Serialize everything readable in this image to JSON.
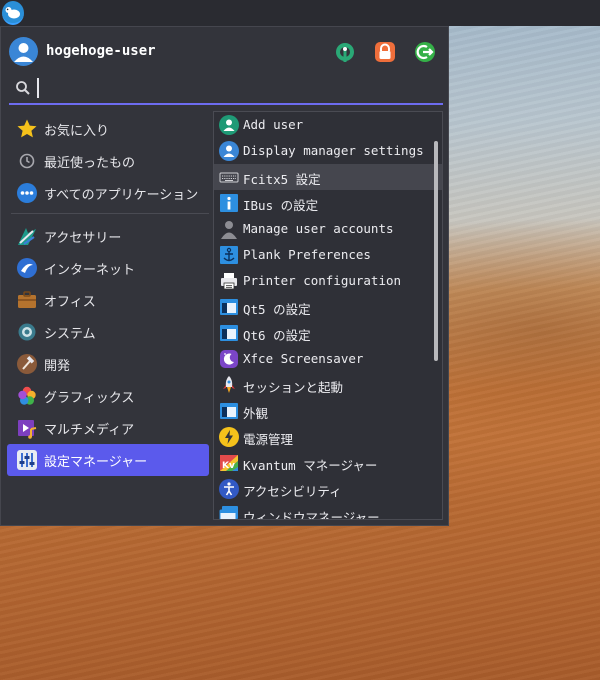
{
  "user": {
    "name": "hogehoge-user"
  },
  "header_buttons": [
    {
      "name": "settings-button",
      "icon": "wrench-gear-icon",
      "color": "#2aa876"
    },
    {
      "name": "lock-button",
      "icon": "lock-icon",
      "color": "#ef6e3b"
    },
    {
      "name": "logout-button",
      "icon": "logout-icon",
      "color": "#35b048"
    }
  ],
  "search": {
    "value": "",
    "placeholder": ""
  },
  "categories_top": [
    {
      "label": "お気に入り",
      "icon": "star-icon"
    },
    {
      "label": "最近使ったもの",
      "icon": "clock-icon"
    },
    {
      "label": "すべてのアプリケーション",
      "icon": "dots-icon"
    }
  ],
  "categories": [
    {
      "label": "アクセサリー",
      "icon": "accessories-icon"
    },
    {
      "label": "インターネット",
      "icon": "internet-icon"
    },
    {
      "label": "オフィス",
      "icon": "briefcase-icon"
    },
    {
      "label": "システム",
      "icon": "system-gear-icon"
    },
    {
      "label": "開発",
      "icon": "hammer-icon"
    },
    {
      "label": "グラフィックス",
      "icon": "graphics-icon"
    },
    {
      "label": "マルチメディア",
      "icon": "multimedia-icon"
    },
    {
      "label": "設定マネージャー",
      "icon": "settings-manager-icon",
      "selected": true
    }
  ],
  "apps": [
    {
      "label": "Add user",
      "icon": "add-user-icon"
    },
    {
      "label": "Display manager settings",
      "icon": "user-icon"
    },
    {
      "label": "Fcitx5 設定",
      "icon": "keyboard-icon",
      "hover": true
    },
    {
      "label": "IBus の設定",
      "icon": "info-icon"
    },
    {
      "label": "Manage user accounts",
      "icon": "users-icon"
    },
    {
      "label": "Plank Preferences",
      "icon": "anchor-icon"
    },
    {
      "label": "Printer configuration",
      "icon": "printer-icon"
    },
    {
      "label": "Qt5 の設定",
      "icon": "window-icon"
    },
    {
      "label": "Qt6 の設定",
      "icon": "window-icon"
    },
    {
      "label": "Xfce Screensaver",
      "icon": "screensaver-icon"
    },
    {
      "label": "セッションと起動",
      "icon": "rocket-icon"
    },
    {
      "label": "外観",
      "icon": "window-icon"
    },
    {
      "label": "電源管理",
      "icon": "power-icon"
    },
    {
      "label": "Kvantum マネージャー",
      "icon": "kvantum-icon"
    },
    {
      "label": "アクセシビリティ",
      "icon": "accessibility-icon"
    },
    {
      "label": "ウィンドウマネージャー",
      "icon": "window-manager-icon"
    }
  ]
}
